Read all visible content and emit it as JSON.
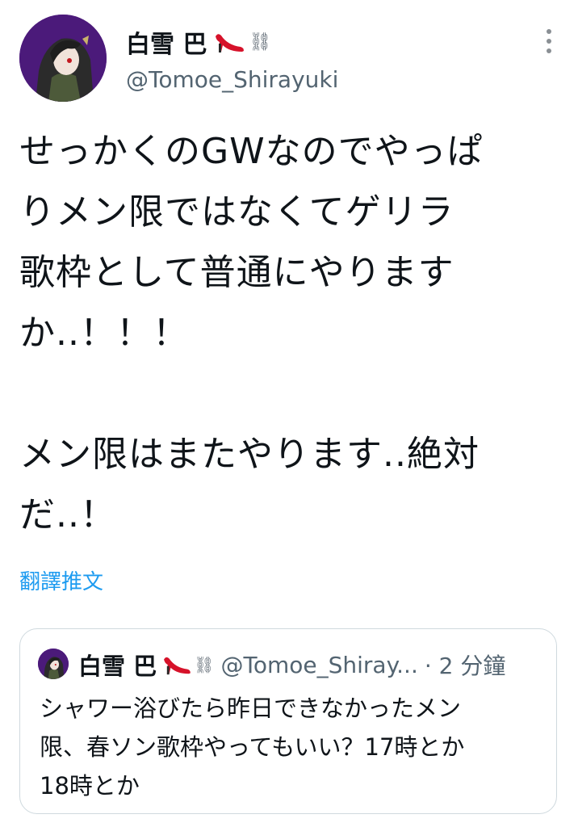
{
  "author": {
    "display_name": "白雪 巴",
    "chain_glyph": "⛓",
    "handle": "@Tomoe_Shirayuki"
  },
  "tweet": {
    "text": "せっかくのGWなのでやっぱ\nりメン限ではなくてゲリラ\n歌枠として普通にやります\nか..！！！\n\nメン限はまたやります..絶対\nだ..！",
    "translate_label": "翻譯推文"
  },
  "quote": {
    "display_name": "白雪 巴",
    "chain_glyph": "⛓",
    "handle": "@Tomoe_Shiray...",
    "time": "· 2 分鐘",
    "text": "シャワー浴びたら昨日できなかったメン\n限、春ソン歌枠やってもいい？17時とか\n18時とか"
  },
  "icons": {
    "heel": "high-heel-icon",
    "more": "more-vertical-icon"
  },
  "colors": {
    "link": "#1d9bf0",
    "secondary_text": "#536471",
    "avatar_bg": "#5a1a8a",
    "heel_red": "#d6122a"
  }
}
